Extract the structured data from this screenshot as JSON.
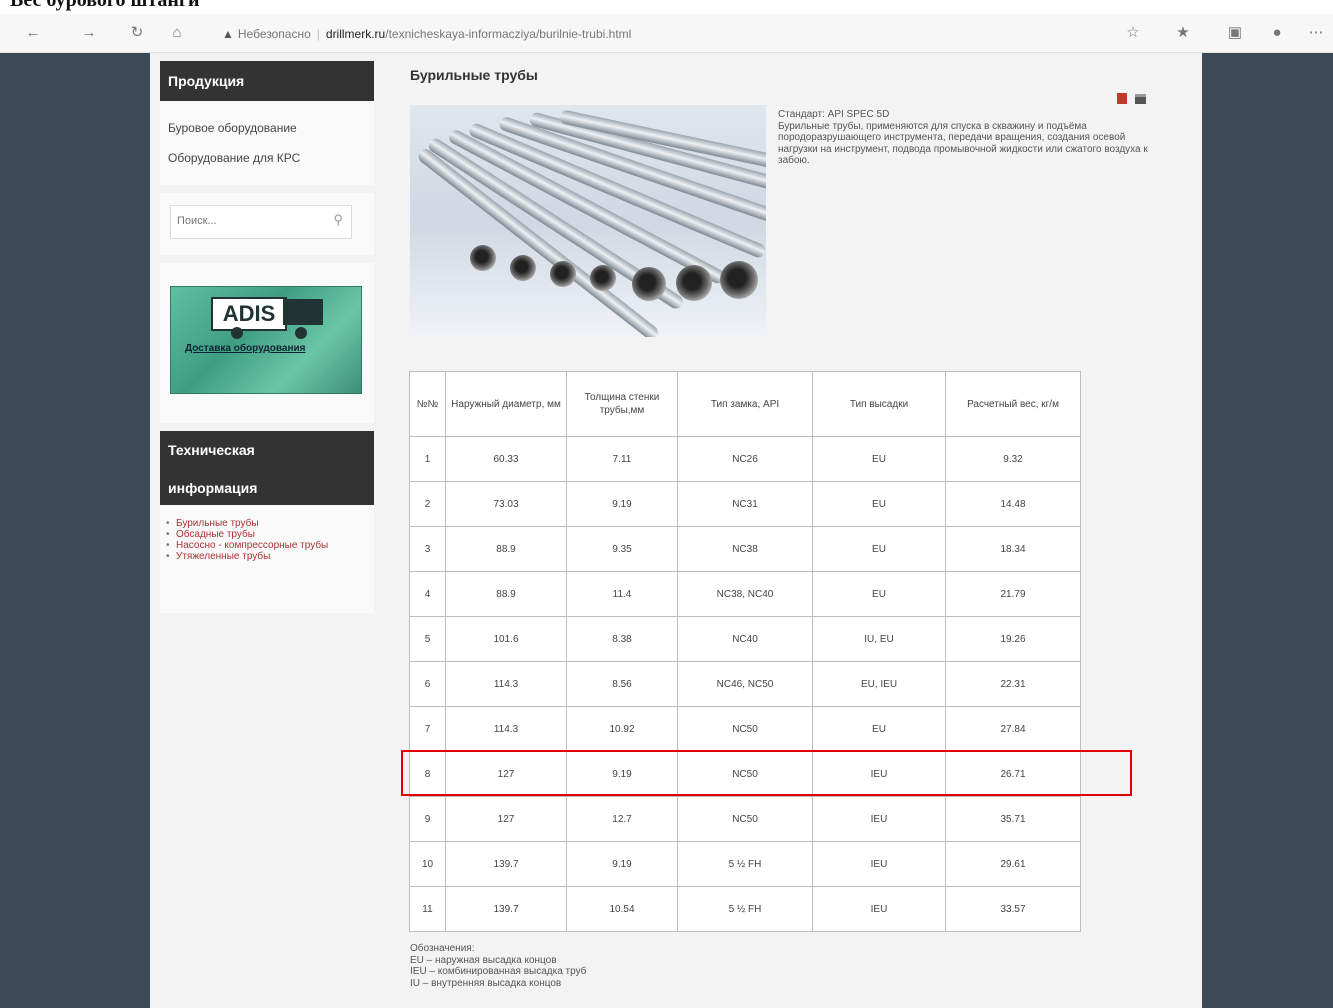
{
  "caption": "Вес бурового штанги",
  "browser": {
    "security_label": "Небезопасно",
    "url_domain": "drillmerk.ru",
    "url_path": "/texnicheskaya-informacziya/burilnie-trubi.html"
  },
  "sidebar": {
    "products_title": "Продукция",
    "products": [
      "Буровое оборудование",
      "Оборудование для КРС"
    ],
    "search_placeholder": "Поиск...",
    "banner_logo": "ADIS",
    "banner_text": "Доставка оборудования",
    "tech_title_line1": "Техническая",
    "tech_title_line2": "информация",
    "tech_items": [
      "Бурильные трубы",
      "Обсадные трубы",
      "Насосно - компрессорные трубы",
      "Утяжеленные трубы"
    ]
  },
  "main": {
    "title": "Бурильные трубы",
    "standard": "Стандарт: API SPEC 5D",
    "description": "Бурильные трубы, применяются для спуска в скважину и подъёма породоразрушающего инструмента, передачи вращения, создания осевой нагрузки на инструмент, подвода промывочной жидкости или сжатого воздуха к забою.",
    "headers": [
      "№№",
      "Наружный диаметр, мм",
      "Толщина стенки трубы,мм",
      "Тип замка, API",
      "Тип высадки",
      "Расчетный вес, кг/м"
    ],
    "rows": [
      [
        "1",
        "60.33",
        "7.11",
        "NC26",
        "EU",
        "9.32"
      ],
      [
        "2",
        "73.03",
        "9.19",
        "NC31",
        "EU",
        "14.48"
      ],
      [
        "3",
        "88.9",
        "9.35",
        "NC38",
        "EU",
        "18.34"
      ],
      [
        "4",
        "88.9",
        "11.4",
        "NC38, NC40",
        "EU",
        "21.79"
      ],
      [
        "5",
        "101.6",
        "8.38",
        "NC40",
        "IU, EU",
        "19.26"
      ],
      [
        "6",
        "114.3",
        "8.56",
        "NC46, NC50",
        "EU, IEU",
        "22.31"
      ],
      [
        "7",
        "114.3",
        "10.92",
        "NC50",
        "EU",
        "27.84"
      ],
      [
        "8",
        "127",
        "9.19",
        "NC50",
        "IEU",
        "26.71"
      ],
      [
        "9",
        "127",
        "12.7",
        "NC50",
        "IEU",
        "35.71"
      ],
      [
        "10",
        "139.7",
        "9.19",
        "5 ½ FH",
        "IEU",
        "29.61"
      ],
      [
        "11",
        "139.7",
        "10.54",
        "5 ½ FH",
        "IEU",
        "33.57"
      ]
    ],
    "legend_title": "Обозначения:",
    "legend": [
      "EU – наружная высадка концов",
      "IEU – комбинированная высадка труб",
      "IU – внутренняя высадка концов"
    ]
  }
}
